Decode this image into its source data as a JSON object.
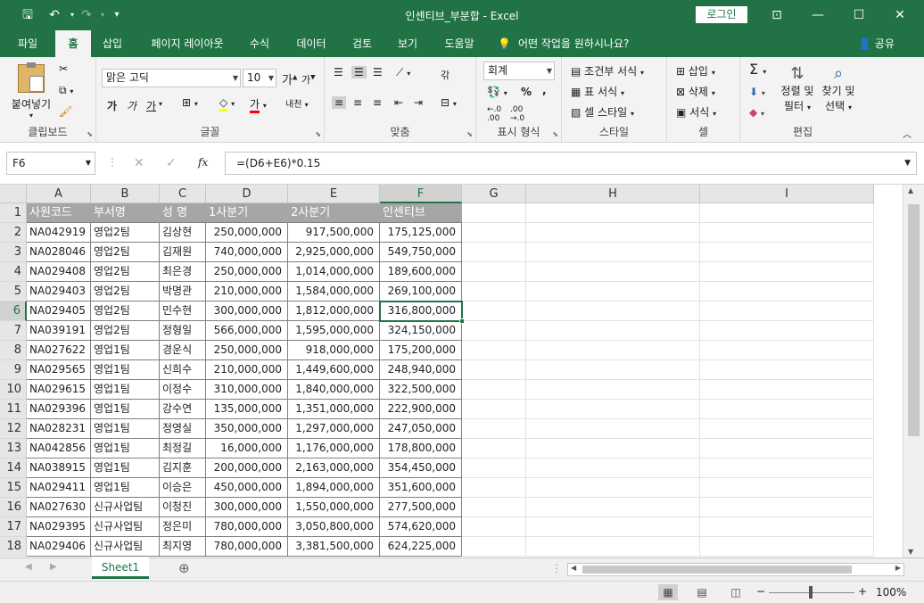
{
  "titlebar": {
    "title": "인센티브_부분합  -  Excel",
    "login_label": "로그인",
    "qat": {
      "save_icon": "save-icon",
      "undo_icon": "undo-icon",
      "redo_icon": "redo-icon",
      "customize_icon": "customize-icon"
    },
    "save_glyph": "🖫",
    "undo_glyph": "↶",
    "redo_glyph": "↷",
    "customize_glyph": "▾",
    "ribbon_display_glyph": "⊡",
    "minimize_glyph": "—",
    "maximize_glyph": "☐",
    "close_glyph": "✕"
  },
  "tabs": [
    {
      "label": "파일"
    },
    {
      "label": "홈"
    },
    {
      "label": "삽입"
    },
    {
      "label": "페이지 레이아웃"
    },
    {
      "label": "수식"
    },
    {
      "label": "데이터"
    },
    {
      "label": "검토"
    },
    {
      "label": "보기"
    },
    {
      "label": "도움말"
    }
  ],
  "tell_me": "어떤 작업을 원하시나요?",
  "share": "공유",
  "ribbon": {
    "clipboard": {
      "label": "클립보드",
      "paste": "붙여넣기"
    },
    "font": {
      "label": "글꼴",
      "font_name": "맑은 고딕",
      "font_size": "10",
      "bold": "가",
      "italic": "가",
      "underline": "가",
      "grow": "가",
      "shrink": "가",
      "phonetic": "내천"
    },
    "alignment": {
      "label": "맞춤",
      "wrap": "갂"
    },
    "number": {
      "label": "표시 형식",
      "format": "회계",
      "percent": "%",
      "comma": ","
    },
    "styles": {
      "label": "스타일",
      "conditional": "조건부 서식",
      "table": "표 서식",
      "cell_styles": "셀 스타일"
    },
    "cells": {
      "label": "셀",
      "insert": "삽입",
      "delete": "삭제",
      "format": "서식"
    },
    "editing": {
      "label": "편집",
      "sort": "정렬 및",
      "sort2": "필터",
      "find": "찾기 및",
      "find2": "선택"
    }
  },
  "formula_bar": {
    "name_box": "F6",
    "formula": "=(D6+E6)*0.15",
    "fx": "fx",
    "cancel": "✕",
    "enter": "✓",
    "dots": "⋮"
  },
  "columns": [
    "A",
    "B",
    "C",
    "D",
    "E",
    "F",
    "G",
    "H",
    "I"
  ],
  "row_numbers": [
    "1",
    "2",
    "3",
    "4",
    "5",
    "6",
    "7",
    "8",
    "9",
    "10",
    "11",
    "12",
    "13",
    "14",
    "15",
    "16",
    "17",
    "18"
  ],
  "headers": [
    "사원코드",
    "부서명",
    "성  명",
    "1사분기",
    "2사분기",
    "인센티브"
  ],
  "rows": [
    [
      "NA042919",
      "영업2팀",
      "김상현",
      "250,000,000",
      "917,500,000",
      "175,125,000"
    ],
    [
      "NA028046",
      "영업2팀",
      "김재원",
      "740,000,000",
      "2,925,000,000",
      "549,750,000"
    ],
    [
      "NA029408",
      "영업2팀",
      "최은경",
      "250,000,000",
      "1,014,000,000",
      "189,600,000"
    ],
    [
      "NA029403",
      "영업2팀",
      "박명관",
      "210,000,000",
      "1,584,000,000",
      "269,100,000"
    ],
    [
      "NA029405",
      "영업2팀",
      "민수현",
      "300,000,000",
      "1,812,000,000",
      "316,800,000"
    ],
    [
      "NA039191",
      "영업2팀",
      "정형일",
      "566,000,000",
      "1,595,000,000",
      "324,150,000"
    ],
    [
      "NA027622",
      "영업1팀",
      "경운식",
      "250,000,000",
      "918,000,000",
      "175,200,000"
    ],
    [
      "NA029565",
      "영업1팀",
      "신희수",
      "210,000,000",
      "1,449,600,000",
      "248,940,000"
    ],
    [
      "NA029615",
      "영업1팀",
      "이정수",
      "310,000,000",
      "1,840,000,000",
      "322,500,000"
    ],
    [
      "NA029396",
      "영업1팀",
      "강수연",
      "135,000,000",
      "1,351,000,000",
      "222,900,000"
    ],
    [
      "NA028231",
      "영업1팀",
      "정영실",
      "350,000,000",
      "1,297,000,000",
      "247,050,000"
    ],
    [
      "NA042856",
      "영업1팀",
      "최정길",
      "16,000,000",
      "1,176,000,000",
      "178,800,000"
    ],
    [
      "NA038915",
      "영업1팀",
      "김지훈",
      "200,000,000",
      "2,163,000,000",
      "354,450,000"
    ],
    [
      "NA029411",
      "영업1팀",
      "이승은",
      "450,000,000",
      "1,894,000,000",
      "351,600,000"
    ],
    [
      "NA027630",
      "신규사업팀",
      "이청진",
      "300,000,000",
      "1,550,000,000",
      "277,500,000"
    ],
    [
      "NA029395",
      "신규사업팀",
      "정은미",
      "780,000,000",
      "3,050,800,000",
      "574,620,000"
    ],
    [
      "NA029406",
      "신규사업팀",
      "최지영",
      "780,000,000",
      "3,381,500,000",
      "624,225,000"
    ]
  ],
  "selected_cell": "F6",
  "sheet_tab": "Sheet1",
  "status": {
    "zoom": "100%",
    "zoom_out": "−",
    "zoom_in": "+"
  }
}
